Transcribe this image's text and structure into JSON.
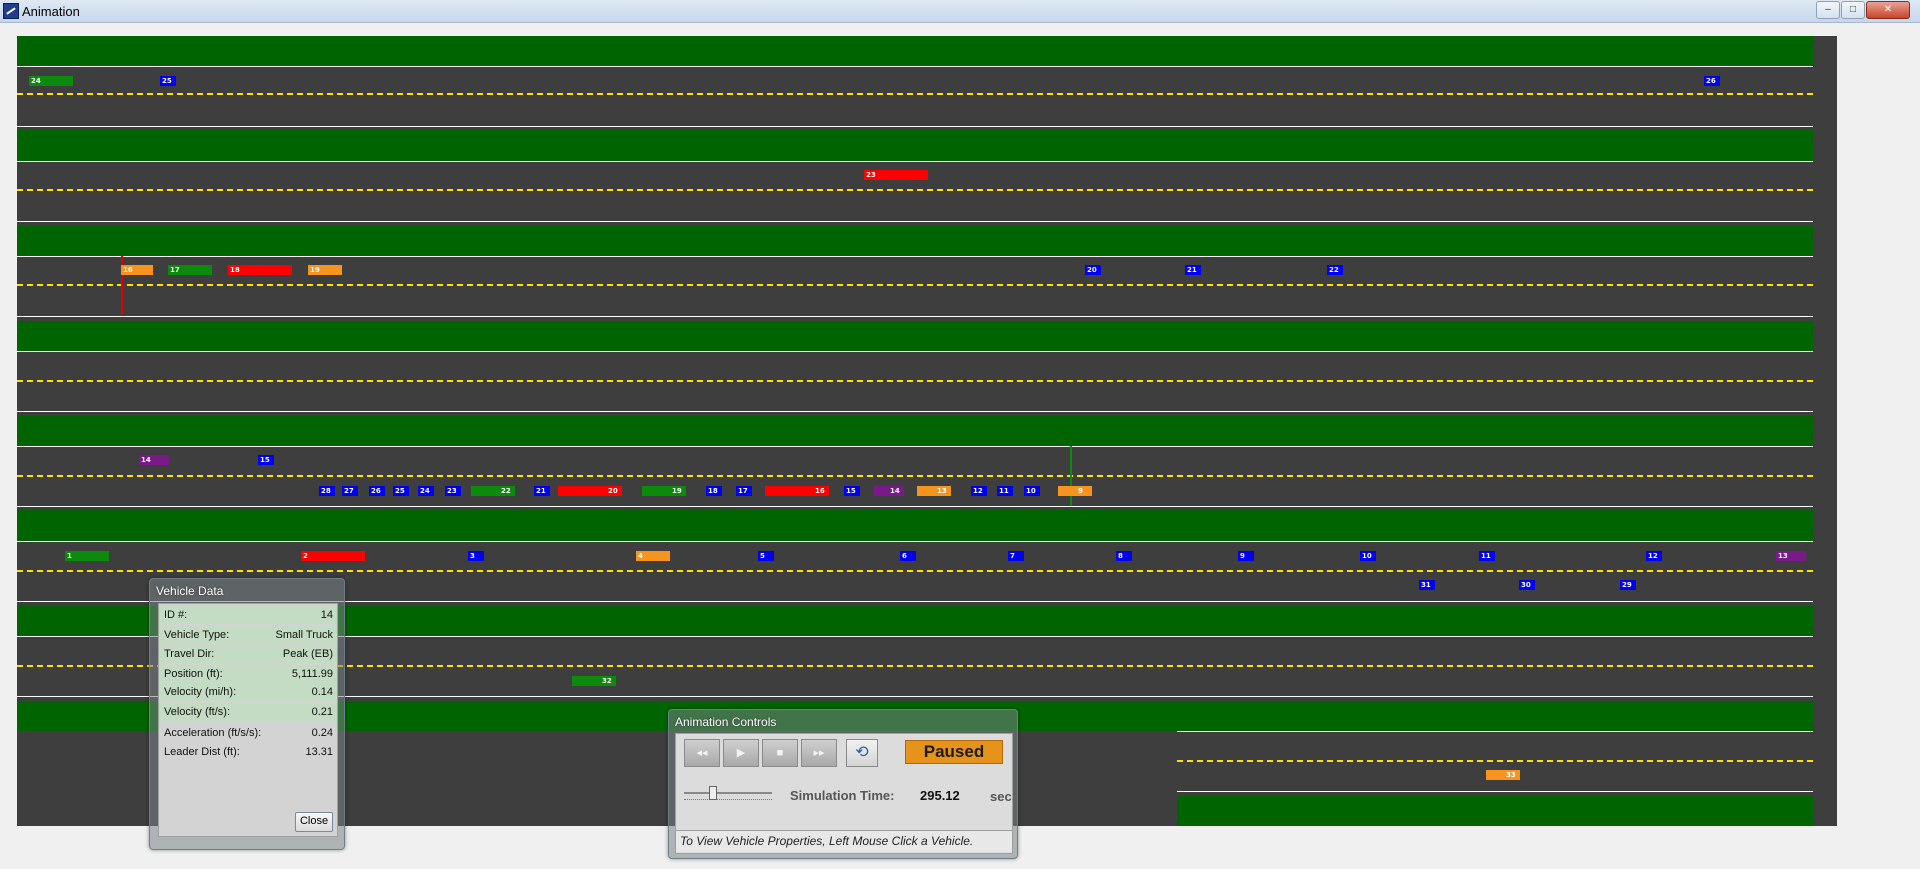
{
  "window": {
    "title": "Animation",
    "minimize": "‒",
    "maximize": "□",
    "close": "✕"
  },
  "colors": {
    "grass": "#006400",
    "road": "#3e3e3e",
    "lane_edge": "#ffffff",
    "center_line": "#ffe000",
    "vehicle_blue": "#0000ee",
    "vehicle_green": "#0b8a0b",
    "vehicle_red": "#ff0000",
    "vehicle_orange": "#f7941d",
    "vehicle_purple": "#7a1a8a",
    "status_paused": "#e6931b"
  },
  "vehicles": {
    "row1": [
      {
        "id": "24",
        "color": "green"
      },
      {
        "id": "25",
        "color": "blue"
      },
      {
        "id": "26",
        "color": "blue"
      }
    ],
    "row2": [
      {
        "id": "23",
        "color": "red"
      }
    ],
    "row3": [
      {
        "id": "16",
        "color": "orange"
      },
      {
        "id": "17",
        "color": "green"
      },
      {
        "id": "18",
        "color": "red"
      },
      {
        "id": "19",
        "color": "orange"
      },
      {
        "id": "20",
        "color": "blue"
      },
      {
        "id": "21",
        "color": "blue"
      },
      {
        "id": "22",
        "color": "blue"
      }
    ],
    "row5a": [
      {
        "id": "14",
        "color": "purple"
      },
      {
        "id": "15",
        "color": "blue"
      }
    ],
    "row5b": [
      {
        "id": "28",
        "color": "blue"
      },
      {
        "id": "27",
        "color": "blue"
      },
      {
        "id": "26",
        "color": "blue"
      },
      {
        "id": "25",
        "color": "blue"
      },
      {
        "id": "24",
        "color": "blue"
      },
      {
        "id": "23",
        "color": "blue"
      },
      {
        "id": "22",
        "color": "green"
      },
      {
        "id": "21",
        "color": "blue"
      },
      {
        "id": "20",
        "color": "red"
      },
      {
        "id": "19",
        "color": "green"
      },
      {
        "id": "18",
        "color": "blue"
      },
      {
        "id": "17",
        "color": "blue"
      },
      {
        "id": "16",
        "color": "red"
      },
      {
        "id": "15",
        "color": "blue"
      },
      {
        "id": "14",
        "color": "purple"
      },
      {
        "id": "13",
        "color": "orange"
      },
      {
        "id": "12",
        "color": "blue"
      },
      {
        "id": "11",
        "color": "blue"
      },
      {
        "id": "10",
        "color": "blue"
      },
      {
        "id": "9",
        "color": "orange"
      }
    ],
    "row6a": [
      {
        "id": "1",
        "color": "green"
      },
      {
        "id": "2",
        "color": "red"
      },
      {
        "id": "3",
        "color": "blue"
      },
      {
        "id": "4",
        "color": "orange"
      },
      {
        "id": "5",
        "color": "blue"
      },
      {
        "id": "6",
        "color": "blue"
      },
      {
        "id": "7",
        "color": "blue"
      },
      {
        "id": "8",
        "color": "blue"
      },
      {
        "id": "9",
        "color": "blue"
      },
      {
        "id": "10",
        "color": "blue"
      },
      {
        "id": "11",
        "color": "blue"
      },
      {
        "id": "12",
        "color": "blue"
      },
      {
        "id": "13",
        "color": "purple"
      }
    ],
    "row6b": [
      {
        "id": "31",
        "color": "blue"
      },
      {
        "id": "30",
        "color": "blue"
      },
      {
        "id": "29",
        "color": "blue"
      }
    ],
    "row7": [
      {
        "id": "32",
        "color": "green"
      }
    ],
    "row8": [
      {
        "id": "33",
        "color": "orange"
      }
    ]
  },
  "vehicle_data": {
    "title": "Vehicle Data",
    "rows": [
      {
        "label": "ID #:",
        "value": "14"
      },
      {
        "label": "Vehicle Type:",
        "value": "Small Truck"
      },
      {
        "label": "Travel Dir:",
        "value": "Peak (EB)"
      },
      {
        "label": "Position (ft):",
        "value": "5,111.99"
      },
      {
        "label": "Velocity (mi/h):",
        "value": "0.14"
      },
      {
        "label": "Velocity (ft/s):",
        "value": "0.21"
      },
      {
        "label": "Acceleration (ft/s/s):",
        "value": "0.24"
      },
      {
        "label": "Leader Dist (ft):",
        "value": "13.31"
      }
    ],
    "close_label": "Close"
  },
  "animation_controls": {
    "title": "Animation Controls",
    "status": "Paused",
    "sim_time_label": "Simulation Time:",
    "sim_time_value": "295.12",
    "sim_time_unit": "sec",
    "hint": "To View Vehicle Properties, Left Mouse Click a Vehicle.",
    "speed_level": 0.3
  }
}
